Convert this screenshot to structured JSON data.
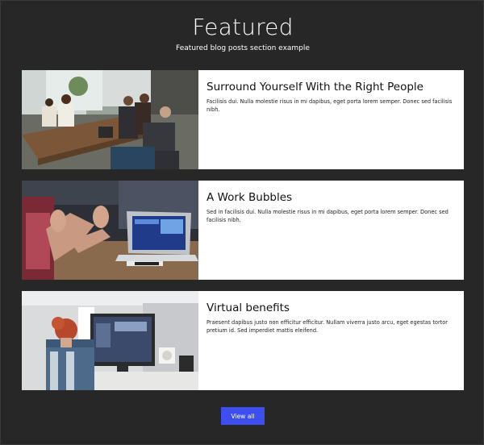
{
  "header": {
    "title": "Featured",
    "subtitle": "Featured blog posts section example"
  },
  "posts": [
    {
      "title": "Surround Yourself With the Right People",
      "excerpt": "Facilisis dui. Nulla molestie risus in mi dapibus, eget porta lorem semper. Donec sed facilisis nibh."
    },
    {
      "title": "A Work Bubbles",
      "excerpt": "Sed in facilisis dui. Nulla molestie risus in mi dapibus, eget porta lorem semper. Donec sed facilisis nibh."
    },
    {
      "title": "Virtual benefits",
      "excerpt": "Praesent dapibus justo non efficitur efficitur. Nullam viverra justo arcu, eget egestas tortor pretium id. Sed imperdiet mattis eleifend."
    }
  ],
  "cta": {
    "label": "View all"
  },
  "colors": {
    "background": "#272727",
    "card": "#ffffff",
    "button": "#3d4ff0"
  }
}
